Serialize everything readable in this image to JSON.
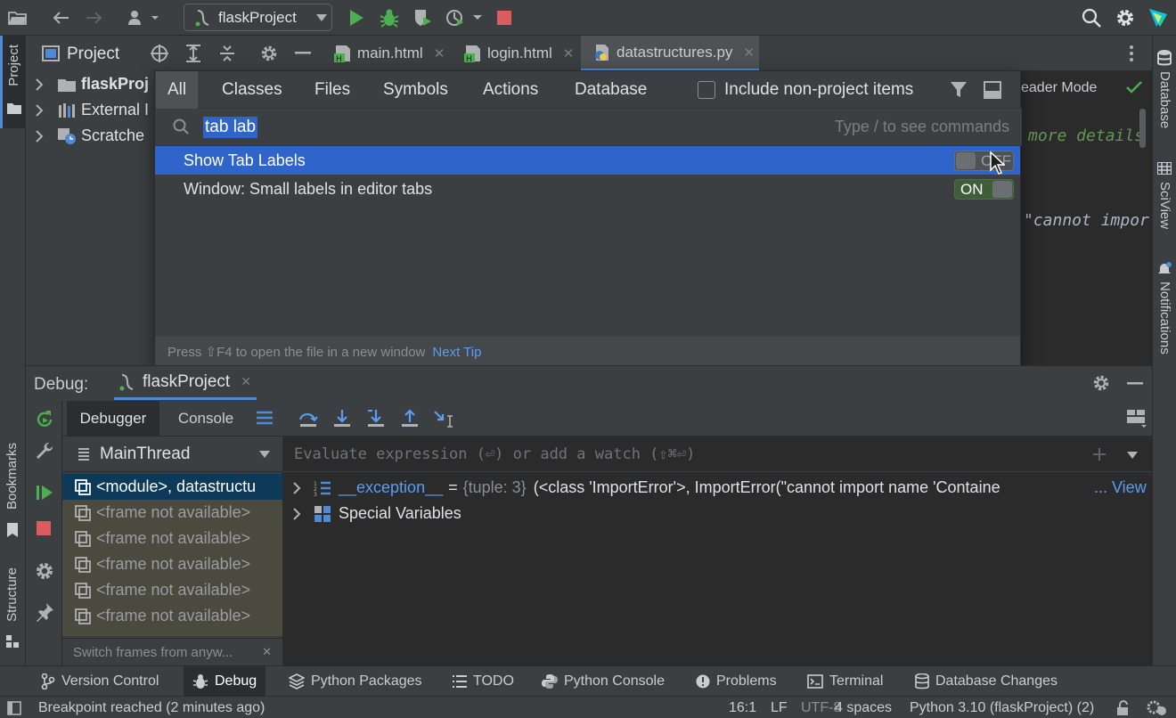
{
  "toolbar": {
    "run_config": "flaskProject",
    "colors": {
      "run": "#4caf50",
      "stop": "#db5c5c"
    }
  },
  "left_stripe": {
    "project_label": "Project",
    "bookmarks_label": "Bookmarks",
    "structure_label": "Structure"
  },
  "right_stripe": {
    "database_label": "Database",
    "sciview_label": "SciView",
    "notifications_label": "Notifications"
  },
  "project": {
    "title": "Project",
    "tree": [
      {
        "label": "flaskProj",
        "icon": "folder-icon"
      },
      {
        "label": "External I",
        "icon": "library-icon"
      },
      {
        "label": "Scratche",
        "icon": "scratches-icon"
      }
    ]
  },
  "editor": {
    "tabs": [
      {
        "label": "main.html"
      },
      {
        "label": "login.html"
      },
      {
        "label": "datastructures.py"
      }
    ],
    "reader_mode": "eader Mode",
    "code_line1": "more details",
    "code_line2": "\"cannot impor"
  },
  "search_popup": {
    "tabs": [
      "All",
      "Classes",
      "Files",
      "Symbols",
      "Actions",
      "Database"
    ],
    "include_non_project": "Include non-project items",
    "query": "tab lab",
    "hint": "Type / to see commands",
    "results": [
      {
        "label": "Show Tab Labels",
        "toggle": "OFF"
      },
      {
        "label": "Window: Small labels in editor tabs",
        "toggle": "ON"
      }
    ],
    "footer_text": "Press ⇧F4 to open the file in a new window",
    "footer_link": "Next Tip"
  },
  "debug": {
    "title": "Debug:",
    "session": "flaskProject",
    "tabs": [
      "Debugger",
      "Console"
    ],
    "thread": "MainThread",
    "evaluate_placeholder": "Evaluate expression (⏎) or add a watch (⇧⌘⏎)",
    "frames": [
      "<module>, datastructu",
      "<frame not available>",
      "<frame not available>",
      "<frame not available>",
      "<frame not available>",
      "<frame not available>"
    ],
    "frames_hint": "Switch frames from anyw...",
    "variables": [
      {
        "name": "__exception__",
        "eq": "=",
        "type": "{tuple: 3}",
        "value": "(<class 'ImportError'>, ImportError(\"cannot import name 'Containe",
        "more": "... View"
      },
      {
        "name": "Special Variables"
      }
    ]
  },
  "bottom_tools": [
    "Version Control",
    "Debug",
    "Python Packages",
    "TODO",
    "Python Console",
    "Problems",
    "Terminal",
    "Database Changes"
  ],
  "status": {
    "message": "Breakpoint reached (2 minutes ago)",
    "position": "16:1",
    "line_sep": "LF",
    "encoding": "UTF-8",
    "indent": "4 spaces",
    "interpreter": "Python 3.10 (flaskProject) (2)"
  }
}
